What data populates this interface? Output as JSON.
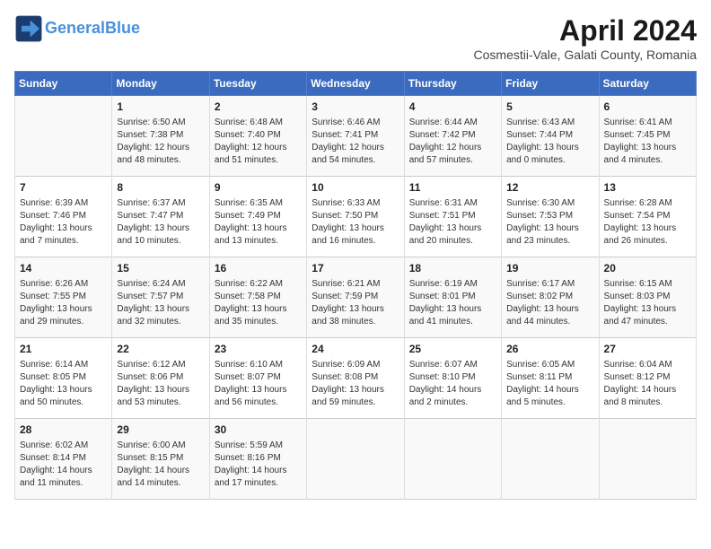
{
  "header": {
    "logo_line1": "General",
    "logo_line2": "Blue",
    "month_title": "April 2024",
    "subtitle": "Cosmestii-Vale, Galati County, Romania"
  },
  "days_of_week": [
    "Sunday",
    "Monday",
    "Tuesday",
    "Wednesday",
    "Thursday",
    "Friday",
    "Saturday"
  ],
  "weeks": [
    [
      {
        "num": "",
        "info": ""
      },
      {
        "num": "1",
        "info": "Sunrise: 6:50 AM\nSunset: 7:38 PM\nDaylight: 12 hours\nand 48 minutes."
      },
      {
        "num": "2",
        "info": "Sunrise: 6:48 AM\nSunset: 7:40 PM\nDaylight: 12 hours\nand 51 minutes."
      },
      {
        "num": "3",
        "info": "Sunrise: 6:46 AM\nSunset: 7:41 PM\nDaylight: 12 hours\nand 54 minutes."
      },
      {
        "num": "4",
        "info": "Sunrise: 6:44 AM\nSunset: 7:42 PM\nDaylight: 12 hours\nand 57 minutes."
      },
      {
        "num": "5",
        "info": "Sunrise: 6:43 AM\nSunset: 7:44 PM\nDaylight: 13 hours\nand 0 minutes."
      },
      {
        "num": "6",
        "info": "Sunrise: 6:41 AM\nSunset: 7:45 PM\nDaylight: 13 hours\nand 4 minutes."
      }
    ],
    [
      {
        "num": "7",
        "info": "Sunrise: 6:39 AM\nSunset: 7:46 PM\nDaylight: 13 hours\nand 7 minutes."
      },
      {
        "num": "8",
        "info": "Sunrise: 6:37 AM\nSunset: 7:47 PM\nDaylight: 13 hours\nand 10 minutes."
      },
      {
        "num": "9",
        "info": "Sunrise: 6:35 AM\nSunset: 7:49 PM\nDaylight: 13 hours\nand 13 minutes."
      },
      {
        "num": "10",
        "info": "Sunrise: 6:33 AM\nSunset: 7:50 PM\nDaylight: 13 hours\nand 16 minutes."
      },
      {
        "num": "11",
        "info": "Sunrise: 6:31 AM\nSunset: 7:51 PM\nDaylight: 13 hours\nand 20 minutes."
      },
      {
        "num": "12",
        "info": "Sunrise: 6:30 AM\nSunset: 7:53 PM\nDaylight: 13 hours\nand 23 minutes."
      },
      {
        "num": "13",
        "info": "Sunrise: 6:28 AM\nSunset: 7:54 PM\nDaylight: 13 hours\nand 26 minutes."
      }
    ],
    [
      {
        "num": "14",
        "info": "Sunrise: 6:26 AM\nSunset: 7:55 PM\nDaylight: 13 hours\nand 29 minutes."
      },
      {
        "num": "15",
        "info": "Sunrise: 6:24 AM\nSunset: 7:57 PM\nDaylight: 13 hours\nand 32 minutes."
      },
      {
        "num": "16",
        "info": "Sunrise: 6:22 AM\nSunset: 7:58 PM\nDaylight: 13 hours\nand 35 minutes."
      },
      {
        "num": "17",
        "info": "Sunrise: 6:21 AM\nSunset: 7:59 PM\nDaylight: 13 hours\nand 38 minutes."
      },
      {
        "num": "18",
        "info": "Sunrise: 6:19 AM\nSunset: 8:01 PM\nDaylight: 13 hours\nand 41 minutes."
      },
      {
        "num": "19",
        "info": "Sunrise: 6:17 AM\nSunset: 8:02 PM\nDaylight: 13 hours\nand 44 minutes."
      },
      {
        "num": "20",
        "info": "Sunrise: 6:15 AM\nSunset: 8:03 PM\nDaylight: 13 hours\nand 47 minutes."
      }
    ],
    [
      {
        "num": "21",
        "info": "Sunrise: 6:14 AM\nSunset: 8:05 PM\nDaylight: 13 hours\nand 50 minutes."
      },
      {
        "num": "22",
        "info": "Sunrise: 6:12 AM\nSunset: 8:06 PM\nDaylight: 13 hours\nand 53 minutes."
      },
      {
        "num": "23",
        "info": "Sunrise: 6:10 AM\nSunset: 8:07 PM\nDaylight: 13 hours\nand 56 minutes."
      },
      {
        "num": "24",
        "info": "Sunrise: 6:09 AM\nSunset: 8:08 PM\nDaylight: 13 hours\nand 59 minutes."
      },
      {
        "num": "25",
        "info": "Sunrise: 6:07 AM\nSunset: 8:10 PM\nDaylight: 14 hours\nand 2 minutes."
      },
      {
        "num": "26",
        "info": "Sunrise: 6:05 AM\nSunset: 8:11 PM\nDaylight: 14 hours\nand 5 minutes."
      },
      {
        "num": "27",
        "info": "Sunrise: 6:04 AM\nSunset: 8:12 PM\nDaylight: 14 hours\nand 8 minutes."
      }
    ],
    [
      {
        "num": "28",
        "info": "Sunrise: 6:02 AM\nSunset: 8:14 PM\nDaylight: 14 hours\nand 11 minutes."
      },
      {
        "num": "29",
        "info": "Sunrise: 6:00 AM\nSunset: 8:15 PM\nDaylight: 14 hours\nand 14 minutes."
      },
      {
        "num": "30",
        "info": "Sunrise: 5:59 AM\nSunset: 8:16 PM\nDaylight: 14 hours\nand 17 minutes."
      },
      {
        "num": "",
        "info": ""
      },
      {
        "num": "",
        "info": ""
      },
      {
        "num": "",
        "info": ""
      },
      {
        "num": "",
        "info": ""
      }
    ]
  ]
}
